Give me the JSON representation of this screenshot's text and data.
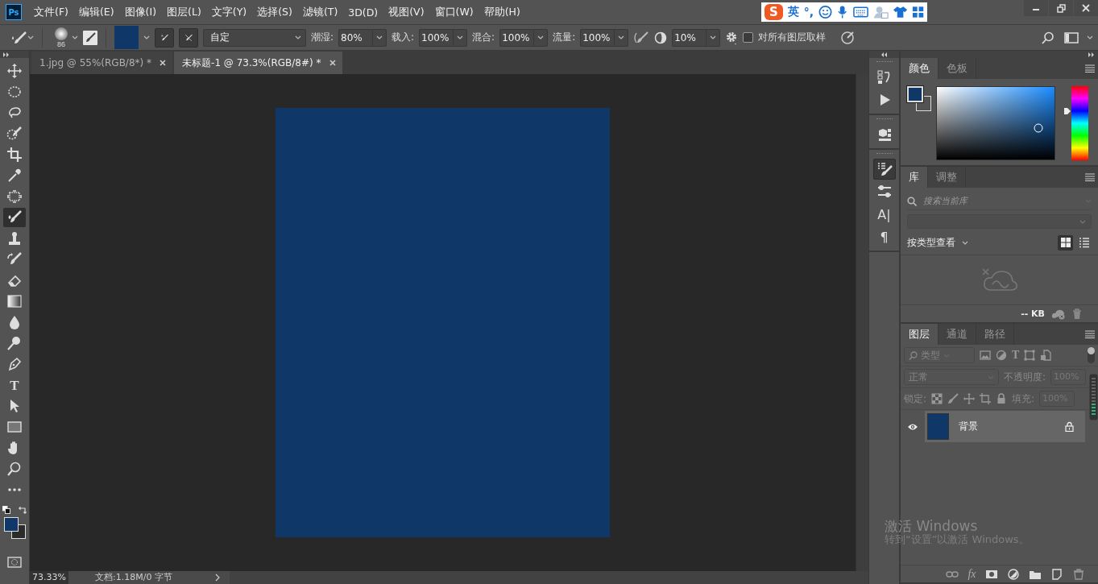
{
  "app_icon": "Ps",
  "menu": [
    "文件(F)",
    "编辑(E)",
    "图像(I)",
    "图层(L)",
    "文字(Y)",
    "选择(S)",
    "滤镜(T)",
    "3D(D)",
    "视图(V)",
    "窗口(W)",
    "帮助(H)"
  ],
  "ime_bar": {
    "logo": "S",
    "mode": "英",
    "punct": "°,"
  },
  "options_bar": {
    "brush_size": "86",
    "preset": "自定",
    "fields": [
      {
        "label": "潮湿:",
        "value": "80%"
      },
      {
        "label": "载入:",
        "value": "100%"
      },
      {
        "label": "混合:",
        "value": "100%"
      },
      {
        "label": "流量:",
        "value": "100%"
      }
    ],
    "smoothing": "10%",
    "sample_all": {
      "label": "对所有图层取样",
      "checked": false
    }
  },
  "doc_tabs": [
    {
      "label": "1.jpg @ 55%(RGB/8*) *",
      "selected": false
    },
    {
      "label": "未标题-1 @ 73.3%(RGB/8#) *",
      "selected": true
    }
  ],
  "tools": [
    {
      "kind": "move",
      "selected": false
    },
    {
      "kind": "marquee",
      "selected": false
    },
    {
      "kind": "lasso",
      "selected": false
    },
    {
      "kind": "quickselect",
      "selected": false
    },
    {
      "kind": "crop",
      "selected": false
    },
    {
      "kind": "eyedropper",
      "selected": false
    },
    {
      "kind": "healing",
      "selected": false
    },
    {
      "kind": "brush",
      "selected": true
    },
    {
      "kind": "stamp",
      "selected": false
    },
    {
      "kind": "historybrush",
      "selected": false
    },
    {
      "kind": "eraser",
      "selected": false
    },
    {
      "kind": "gradient",
      "selected": false
    },
    {
      "kind": "blur",
      "selected": false
    },
    {
      "kind": "dodge",
      "selected": false
    },
    {
      "kind": "pen",
      "selected": false
    },
    {
      "kind": "type",
      "glyph": "T",
      "selected": false
    },
    {
      "kind": "pathselect",
      "selected": false
    },
    {
      "kind": "rectangle",
      "selected": false
    },
    {
      "kind": "hand",
      "selected": false
    },
    {
      "kind": "zoom",
      "selected": false
    },
    {
      "kind": "more",
      "selected": false
    }
  ],
  "dock": [
    {
      "kind": "history",
      "selected": false
    },
    {
      "kind": "actions",
      "selected": false
    },
    {
      "kind": "threed",
      "selected": false
    },
    {
      "kind": "brushsettings",
      "selected": true
    },
    {
      "kind": "adjust",
      "selected": false
    },
    {
      "kind": "character",
      "glyph": "A|",
      "selected": false
    },
    {
      "kind": "paragraph",
      "glyph": "¶",
      "selected": false
    }
  ],
  "status_bar": {
    "zoom": "73.33%",
    "doc_info": "文档:1.18M/0 字节"
  },
  "color_panel": {
    "tabs": [
      {
        "label": "颜色",
        "selected": true
      },
      {
        "label": "色板",
        "selected": false
      }
    ],
    "hue": {
      "level": 0.66
    }
  },
  "library_panel": {
    "tabs": [
      {
        "label": "库",
        "selected": true
      },
      {
        "label": "调整",
        "selected": false
      }
    ],
    "search_placeholder": "搜索当前库",
    "view_by": "按类型查看",
    "views": [
      {
        "kind": "grid",
        "selected": true
      },
      {
        "kind": "list",
        "selected": false
      }
    ],
    "size": "-- KB"
  },
  "layers_panel": {
    "tabs": [
      {
        "label": "图层",
        "selected": true
      },
      {
        "label": "通道",
        "selected": false
      },
      {
        "label": "路径",
        "selected": false
      }
    ],
    "filter": "类型",
    "filter_type_glyph": "T",
    "blend_mode": "正常",
    "opacity_label": "不透明度:",
    "opacity": "100%",
    "lock_label": "锁定:",
    "fill_label": "填充:",
    "fill": "100%",
    "layers": [
      {
        "name": "背景",
        "visible": true,
        "locked": true,
        "selected": true
      }
    ],
    "fx": "fx"
  },
  "windows_notice": {
    "title": "激活 Windows",
    "hint": "转到“设置”以激活 Windows。"
  }
}
